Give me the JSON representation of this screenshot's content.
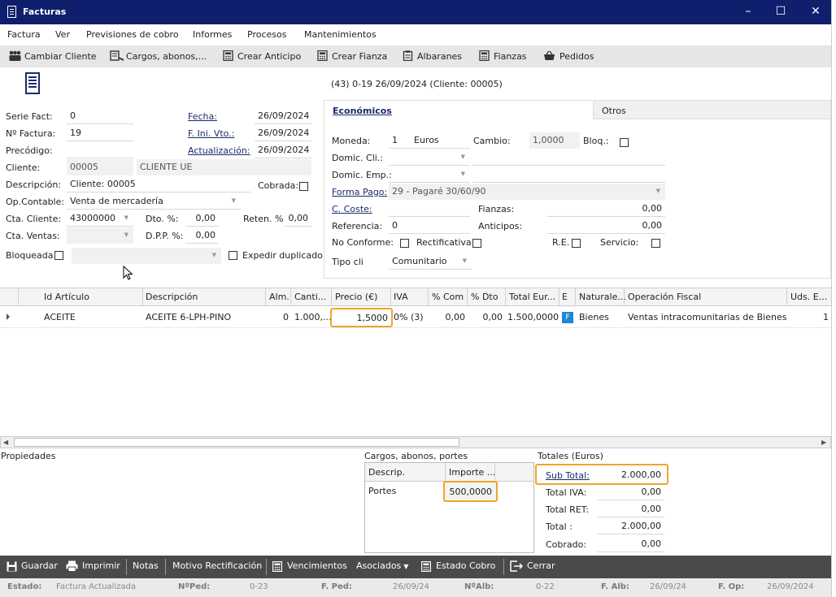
{
  "window": {
    "title": "Facturas"
  },
  "menu": [
    "Factura",
    "Ver",
    "Previsiones de cobro",
    "Informes",
    "Procesos",
    "Mantenimientos"
  ],
  "toolbar": [
    "Cambiar Cliente",
    "Cargos, abonos,...",
    "Crear Anticipo",
    "Crear Fianza",
    "Albaranes",
    "Fianzas",
    "Pedidos"
  ],
  "header_info": "(43) 0-19  26/09/2024  (Cliente: 00005)",
  "form": {
    "serie_label": "Serie Fact:",
    "serie": "0",
    "numero_label": "Nº Factura:",
    "numero": "19",
    "precodigo_label": "Precódigo:",
    "precodigo": "",
    "cliente_label": "Cliente:",
    "cliente_code": "00005",
    "cliente_name": "CLIENTE UE",
    "descripcion_label": "Descripción:",
    "descripcion": "Cliente: 00005",
    "cobrada_label": "Cobrada:",
    "opcontable_label": "Op.Contable:",
    "opcontable": "Venta de mercadería",
    "ctacliente_label": "Cta. Cliente:",
    "ctacliente": "43000000",
    "dto_label": "Dto. %:",
    "dto": "0,00",
    "reten_label": "Reten. %",
    "reten": "0,00",
    "ctaventas_label": "Cta. Ventas:",
    "ctaventas": "",
    "dpp_label": "D.P.P. %:",
    "dpp": "0,00",
    "bloqueada_label": "Bloqueada",
    "expedir_label": "Expedir duplicado",
    "fecha_label": "Fecha:",
    "fecha": "26/09/2024",
    "fivto_label": "F. Ini. Vto.:",
    "fivto": "26/09/2024",
    "actualizacion_label": "Actualización:",
    "actualizacion": "26/09/2024"
  },
  "tabs": [
    "Económicos",
    "Otros"
  ],
  "economicos": {
    "moneda_label": "Moneda:",
    "moneda_code": "1",
    "moneda_name": "Euros",
    "cambio_label": "Cambio:",
    "cambio": "1,0000",
    "bloq_label": "Bloq.:",
    "domcli_label": "Domic. Cli.:",
    "domemp_label": "Domic. Emp.:",
    "formapago_label": "Forma Pago:",
    "formapago": "29 - Pagaré 30/60/90",
    "ccoste_label": "C. Coste:",
    "fianzas_label": "Fianzas:",
    "fianzas": "0,00",
    "referencia_label": "Referencia:",
    "referencia": "0",
    "anticipos_label": "Anticipos:",
    "anticipos": "0,00",
    "noconforme_label": "No Conforme:",
    "rectificativa_label": "Rectificativa",
    "re_label": "R.E.",
    "servicio_label": "Servicio:",
    "tipocli_label": "Tipo cli",
    "tipocli": "Comunitario"
  },
  "grid": {
    "columns": [
      "Id Artículo",
      "Descripción",
      "Alm.",
      "Canti...",
      "Precio (€)",
      "IVA",
      "% Com",
      "% Dto",
      "Total Eur...",
      "E",
      "Naturale...",
      "Operación Fiscal",
      "Uds. E..."
    ],
    "rows": [
      {
        "id": "ACEITE",
        "desc": "ACEITE 6-LPH-PINO",
        "alm": "0",
        "cant": "1.000,...",
        "precio": "1,5000",
        "iva": "0% (3)",
        "com": "0,00",
        "dto": "0,00",
        "total": "1.500,0000",
        "e": "F",
        "nat": "Bienes",
        "opfiscal": "Ventas intracomunitarias de Bienes",
        "uds": "1"
      }
    ]
  },
  "propiedades_label": "Propiedades",
  "cargos": {
    "title": "Cargos, abonos, portes",
    "columns": [
      "Descrip.",
      "Importe ..."
    ],
    "rows": [
      {
        "desc": "Portes",
        "importe": "500,0000"
      }
    ]
  },
  "totales": {
    "title": "Totales (Euros)",
    "subtotal_label": "Sub Total:",
    "subtotal": "2.000,00",
    "iva_label": "Total IVA:",
    "iva": "0,00",
    "ret_label": "Total RET:",
    "ret": "0,00",
    "total_label": "Total :",
    "total": "2.000,00",
    "cobrado_label": "Cobrado:",
    "cobrado": "0,00"
  },
  "bottom": [
    "Guardar",
    "Imprimir",
    "Notas",
    "Motivo Rectificación",
    "Vencimientos",
    "Asociados",
    "Estado Cobro",
    "Cerrar"
  ],
  "status": {
    "estado_label": "Estado:",
    "estado": "Factura Actualizada",
    "nped_label": "NºPed:",
    "nped": "0-23",
    "fped_label": "F. Ped:",
    "fped": "26/09/24",
    "nalb_label": "NºAlb:",
    "nalb": "0-22",
    "falb_label": "F. Alb:",
    "falb": "26/09/24",
    "fop_label": "F. Op:",
    "fop": "26/09/2024"
  },
  "colors": {
    "titlebar": "#0f1f6e",
    "highlight": "#f0a52a",
    "bottombar": "#4a4a4a",
    "link": "#1a2b6b"
  }
}
